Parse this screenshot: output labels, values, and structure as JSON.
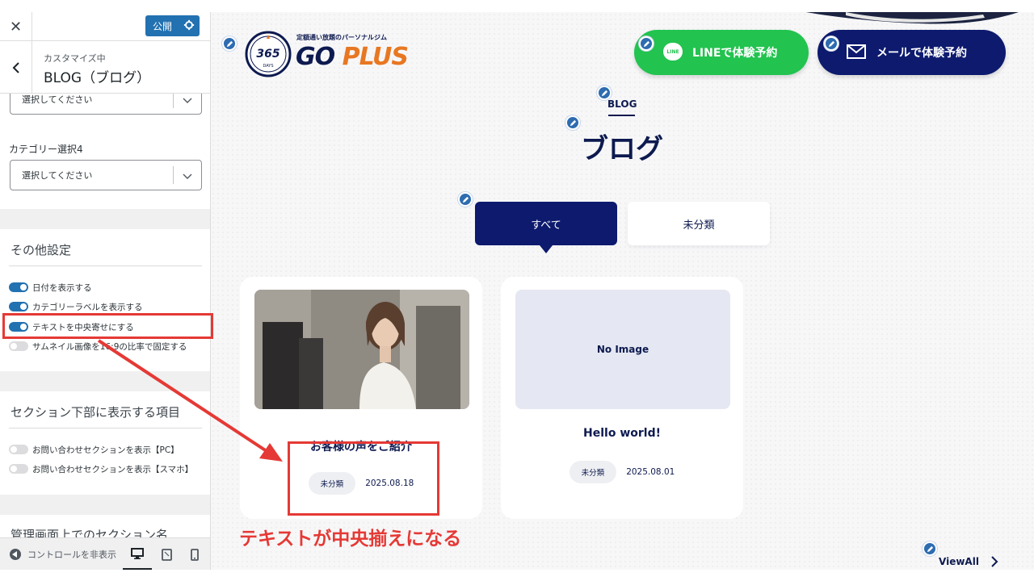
{
  "sidebar": {
    "close_label": "✕",
    "publish_label": "公開",
    "customizing_label": "カスタマイズ中",
    "section_title": "BLOG（ブログ）",
    "select_top_value": "選択してください",
    "category4_label": "カテゴリー選択4",
    "category4_value": "選択してください",
    "other_settings_title": "その他設定",
    "toggles": [
      {
        "label": "日付を表示する",
        "on": true
      },
      {
        "label": "カテゴリーラベルを表示する",
        "on": true
      },
      {
        "label": "テキストを中央寄せにする",
        "on": true
      },
      {
        "label": "サムネイル画像を16:9の比率で固定する",
        "on": false
      }
    ],
    "bottom_section_title": "セクション下部に表示する項目",
    "bottom_toggles": [
      {
        "label": "お問い合わせセクションを表示【PC】",
        "on": false
      },
      {
        "label": "お問い合わせセクションを表示【スマホ】",
        "on": false
      }
    ],
    "admin_section_title": "管理画面上でのセクション名",
    "hide_controls_label": "コントロールを非表示",
    "devices": [
      "desktop-icon",
      "tablet-icon",
      "mobile-icon"
    ]
  },
  "site": {
    "logo_tagline": "定額通い放題のパーソナルジム",
    "logo_badge": "365",
    "logo_go": "GO",
    "logo_plus": "PLUS",
    "line_icon_text": "LINE",
    "line_button": "LINEで体験予約",
    "mail_button": "メールで体験予約",
    "blog_en": "BLOG",
    "blog_jp": "ブログ",
    "tabs": [
      "すべて",
      "未分類"
    ],
    "posts": [
      {
        "title": "お客様の声をご紹介",
        "category": "未分類",
        "date": "2025.08.18",
        "thumbnail": "photo"
      },
      {
        "title": "Hello world!",
        "category": "未分類",
        "date": "2025.08.01",
        "thumbnail": "No Image"
      }
    ],
    "view_all": "ViewAll"
  },
  "annotation": {
    "caption": "テキストが中央揃えになる",
    "color": "#e53935"
  },
  "colors": {
    "navy": "#0d1a6e",
    "line_green": "#22c34f",
    "wp_blue": "#2271b1",
    "accent_orange": "#e87722"
  }
}
